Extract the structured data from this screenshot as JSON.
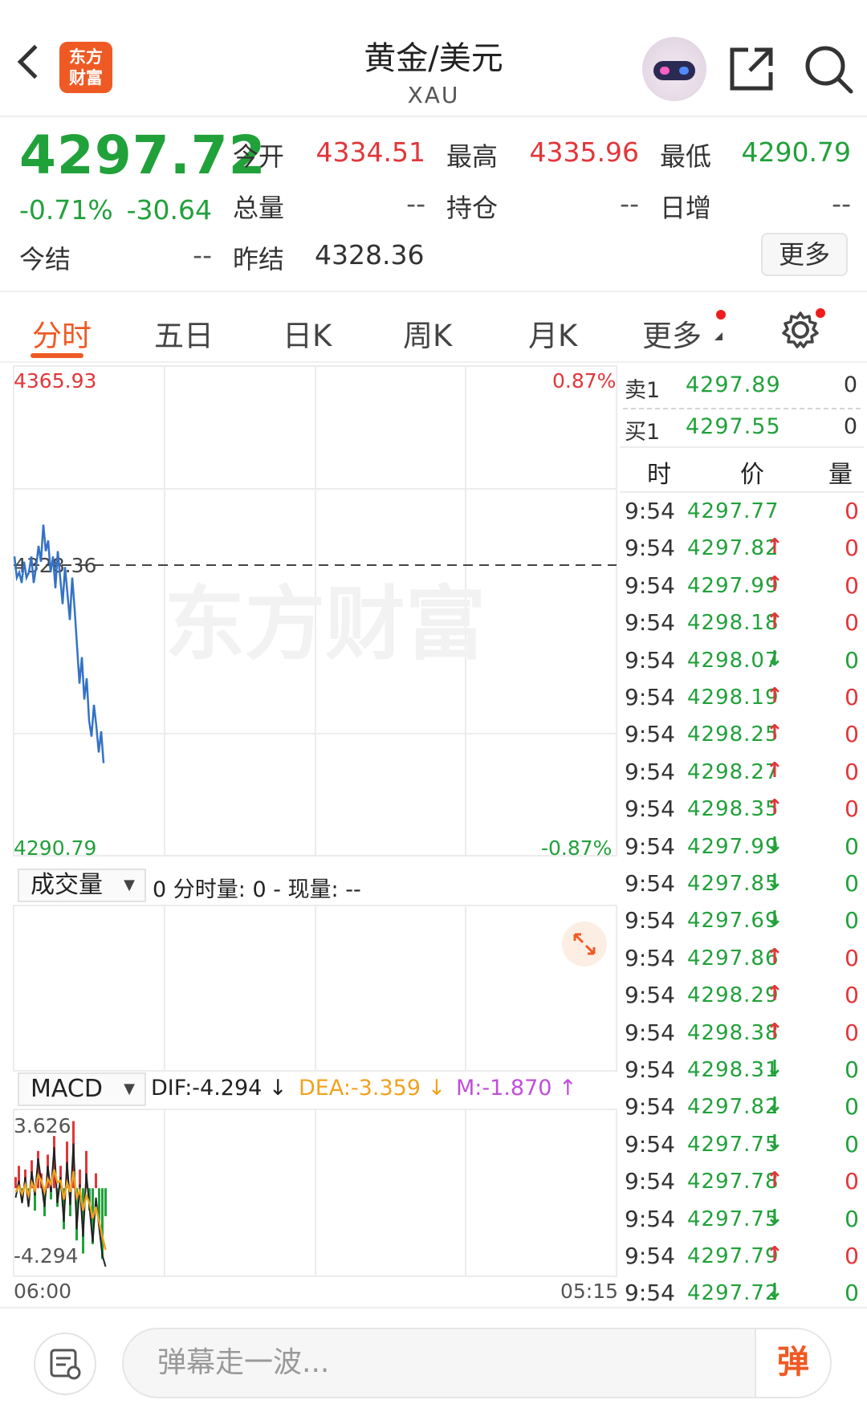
{
  "header": {
    "title": "黄金/美元",
    "subtitle": "XAU",
    "logo_line1": "东方",
    "logo_line2": "财富"
  },
  "quote": {
    "last": "4297.72",
    "change_pct": "-0.71%",
    "change": "-30.64",
    "open_label": "今开",
    "open": "4334.51",
    "high_label": "最高",
    "high": "4335.96",
    "low_label": "最低",
    "low": "4290.79",
    "volume_label": "总量",
    "volume": "--",
    "position_label": "持仓",
    "position": "--",
    "daily_inc_label": "日增",
    "daily_inc": "--",
    "settle_label": "今结",
    "settle": "--",
    "prev_settle_label": "昨结",
    "prev_settle": "4328.36",
    "more_label": "更多"
  },
  "tabs": [
    "分时",
    "五日",
    "日K",
    "周K",
    "月K",
    "更多"
  ],
  "chart": {
    "y_top": "4365.93",
    "y_bottom": "4290.79",
    "pct_top": "0.87%",
    "pct_bottom": "-0.87%",
    "ref_label": "4328.36",
    "watermark": "东方财富",
    "x_start": "06:00",
    "x_end": "05:15"
  },
  "volume_panel": {
    "selector": "成交量",
    "info": "0 分时量: 0 - 现量: --"
  },
  "macd_panel": {
    "selector": "MACD",
    "dif": "DIF:-4.294 ↓",
    "dea": "DEA:-3.359 ↓",
    "m": "M:-1.870 ↑",
    "y_top": "3.626",
    "y_bottom": "-4.294"
  },
  "order_book": {
    "ask_label": "卖1",
    "ask_price": "4297.89",
    "ask_vol": "0",
    "bid_label": "买1",
    "bid_price": "4297.55",
    "bid_vol": "0",
    "col_time": "时",
    "col_price": "价",
    "col_vol": "量"
  },
  "ticks": [
    {
      "time": "9:54",
      "price": "4297.77",
      "dir": "",
      "vol": "0"
    },
    {
      "time": "9:54",
      "price": "4297.82",
      "dir": "up",
      "vol": "0"
    },
    {
      "time": "9:54",
      "price": "4297.99",
      "dir": "up",
      "vol": "0"
    },
    {
      "time": "9:54",
      "price": "4298.18",
      "dir": "up",
      "vol": "0"
    },
    {
      "time": "9:54",
      "price": "4298.07",
      "dir": "down",
      "vol": "0"
    },
    {
      "time": "9:54",
      "price": "4298.19",
      "dir": "up",
      "vol": "0"
    },
    {
      "time": "9:54",
      "price": "4298.25",
      "dir": "up",
      "vol": "0"
    },
    {
      "time": "9:54",
      "price": "4298.27",
      "dir": "up",
      "vol": "0"
    },
    {
      "time": "9:54",
      "price": "4298.35",
      "dir": "up",
      "vol": "0"
    },
    {
      "time": "9:54",
      "price": "4297.99",
      "dir": "down",
      "vol": "0"
    },
    {
      "time": "9:54",
      "price": "4297.85",
      "dir": "down",
      "vol": "0"
    },
    {
      "time": "9:54",
      "price": "4297.69",
      "dir": "down",
      "vol": "0"
    },
    {
      "time": "9:54",
      "price": "4297.86",
      "dir": "up",
      "vol": "0"
    },
    {
      "time": "9:54",
      "price": "4298.29",
      "dir": "up",
      "vol": "0"
    },
    {
      "time": "9:54",
      "price": "4298.38",
      "dir": "up",
      "vol": "0"
    },
    {
      "time": "9:54",
      "price": "4298.31",
      "dir": "down",
      "vol": "0"
    },
    {
      "time": "9:54",
      "price": "4297.82",
      "dir": "down",
      "vol": "0"
    },
    {
      "time": "9:54",
      "price": "4297.75",
      "dir": "down",
      "vol": "0"
    },
    {
      "time": "9:54",
      "price": "4297.78",
      "dir": "up",
      "vol": "0"
    },
    {
      "time": "9:54",
      "price": "4297.75",
      "dir": "down",
      "vol": "0"
    },
    {
      "time": "9:54",
      "price": "4297.79",
      "dir": "up",
      "vol": "0"
    },
    {
      "time": "9:54",
      "price": "4297.72",
      "dir": "down",
      "vol": "0"
    }
  ],
  "bottom": {
    "placeholder": "弹幕走一波...",
    "send_label": "弹"
  },
  "colors": {
    "up": "#e2363a",
    "down": "#21a13a",
    "accent": "#ef5a24",
    "price_line": "#3572c6"
  },
  "chart_data": {
    "type": "line",
    "y_range": [
      4290.79,
      4365.93
    ],
    "reference": 4328.36,
    "price_series": [
      4330,
      4326,
      4327,
      4325,
      4329,
      4326,
      4327,
      4330,
      4325,
      4328,
      4332,
      4329,
      4336,
      4331,
      4333,
      4327,
      4330,
      4324,
      4331,
      4326,
      4321,
      4328,
      4323,
      4318,
      4326,
      4320,
      4313,
      4306,
      4311,
      4303,
      4307,
      4299,
      4296,
      4302,
      4298,
      4293,
      4297,
      4291
    ],
    "macd_range": [
      -4.294,
      3.626
    ],
    "macd_hist": [
      0.6,
      1.2,
      -0.5,
      1.0,
      -0.8,
      1.5,
      -1.2,
      2.0,
      0.8,
      -1.5,
      1.8,
      -0.6,
      2.8,
      -1.0,
      1.2,
      -2.2,
      2.5,
      -1.5,
      3.6,
      -2.8,
      1.0,
      -3.5,
      2.0,
      -1.2,
      -3.0,
      0.8,
      -2.0,
      -3.8,
      -1.5
    ],
    "macd_dif": [
      -0.5,
      0.4,
      -0.8,
      0.6,
      -1.0,
      0.9,
      -0.4,
      1.6,
      0.3,
      -1.0,
      1.2,
      -0.2,
      2.2,
      -0.8,
      0.6,
      -1.8,
      1.4,
      -0.9,
      2.4,
      -2.2,
      0.2,
      -2.6,
      0.8,
      -1.0,
      -2.9,
      -0.5,
      -2.1,
      -3.6,
      -4.2
    ],
    "macd_dea": [
      -0.2,
      0.1,
      -0.3,
      0.2,
      -0.4,
      0.3,
      -0.1,
      0.7,
      0.4,
      -0.2,
      0.5,
      0.2,
      1.0,
      0.3,
      0.4,
      -0.6,
      0.3,
      -0.2,
      0.9,
      -0.5,
      -0.1,
      -1.2,
      -0.4,
      -0.8,
      -1.6,
      -1.0,
      -1.8,
      -2.6,
      -3.3
    ]
  }
}
